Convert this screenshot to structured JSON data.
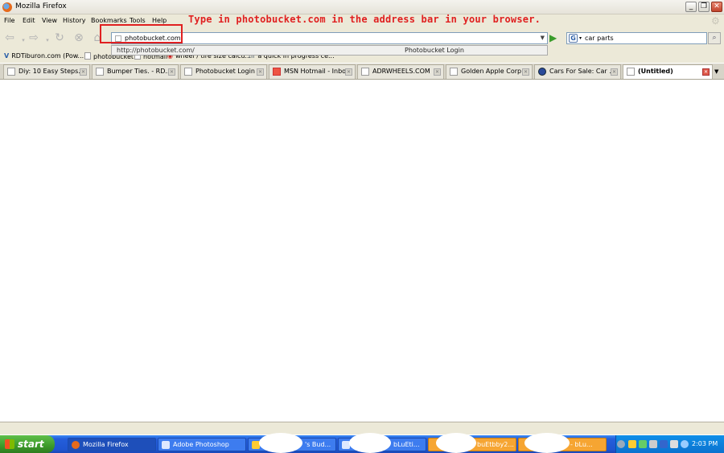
{
  "window": {
    "title": "Mozilla Firefox"
  },
  "menu": [
    "File",
    "Edit",
    "View",
    "History",
    "Bookmarks",
    "Tools",
    "Help"
  ],
  "nav": {
    "url_value": "photobucket.com",
    "search_value": "car parts"
  },
  "annotation": "Type in photobucket.com in the address bar in your browser.",
  "autocomplete": {
    "url": "http://photobucket.com/",
    "title": "Photobucket Login"
  },
  "bookmarks": [
    "RDTiburon.com (Pow...",
    "photobucket",
    "hotmail",
    "wheel / tire size calcu...",
    "a quick in progress ce..."
  ],
  "tabs": [
    "Diy: 10 Easy Steps...",
    "Bumper Ties. - RD...",
    "Photobucket Login",
    "MSN Hotmail - Inbox",
    "ADRWHEELS.COM",
    "Golden Apple Corp...",
    "Cars For Sale: Car ...",
    "(Untitled)"
  ],
  "taskbar": {
    "start": "start",
    "tasks": [
      "Mozilla Firefox",
      "Adobe Photoshop",
      "'s Bud...",
      "bLuEti...",
      "buEtbby2...",
      "- bLu..."
    ],
    "clock": "2:03 PM"
  },
  "colors": {
    "annotation": "#e02020",
    "taskbar": "#245edb",
    "start": "#3c9a2a"
  }
}
